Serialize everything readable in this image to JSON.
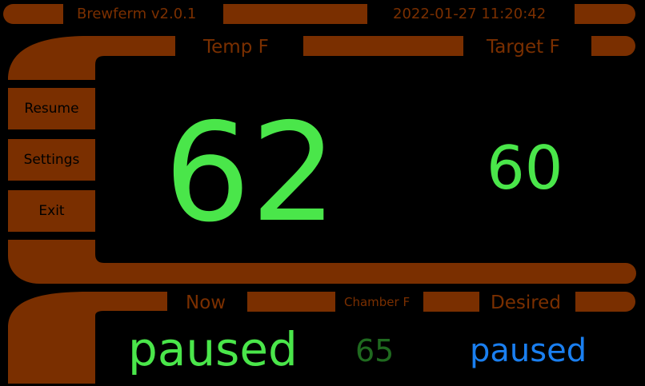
{
  "header": {
    "app_title": "Brewferm v2.0.1",
    "datetime": "2022-01-27 11:20:42"
  },
  "top_panel": {
    "temp_label": "Temp F",
    "target_label": "Target F",
    "temp_value": "62",
    "target_value": "60"
  },
  "buttons": {
    "resume": "Resume",
    "settings": "Settings",
    "exit": "Exit"
  },
  "bottom_panel": {
    "now_label": "Now",
    "chamber_label": "Chamber F",
    "desired_label": "Desired",
    "now_status": "paused",
    "chamber_value": "65",
    "desired_status": "paused"
  },
  "colors": {
    "frame": "#7a2f00",
    "value_green": "#4ae64a",
    "chamber_green": "#1f6a1f",
    "status_blue": "#1a7ff0"
  }
}
